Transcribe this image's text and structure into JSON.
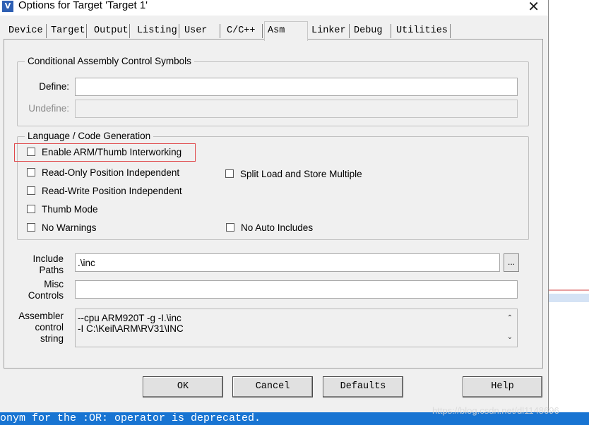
{
  "window": {
    "title": "Options for Target 'Target 1'",
    "close_glyph": "✕",
    "app_icon": "keil-uvision-icon"
  },
  "tabs": [
    {
      "label": "Device"
    },
    {
      "label": "Target"
    },
    {
      "label": "Output"
    },
    {
      "label": "Listing"
    },
    {
      "label": "User"
    },
    {
      "label": "C/C++"
    },
    {
      "label": "Asm",
      "active": true
    },
    {
      "label": "Linker"
    },
    {
      "label": "Debug"
    },
    {
      "label": "Utilities"
    }
  ],
  "conditional": {
    "group_label": "Conditional Assembly Control Symbols",
    "define_label": "Define:",
    "define_value": "",
    "undefine_label": "Undefine:",
    "undefine_value": ""
  },
  "language": {
    "group_label": "Language / Code Generation",
    "options": {
      "interworking": {
        "label": "Enable ARM/Thumb Interworking",
        "checked": false
      },
      "ropi": {
        "label": "Read-Only Position Independent",
        "checked": false
      },
      "rwpi": {
        "label": "Read-Write Position Independent",
        "checked": false
      },
      "thumb": {
        "label": "Thumb Mode",
        "checked": false
      },
      "nowarn": {
        "label": "No Warnings",
        "checked": false
      },
      "split": {
        "label": "Split Load and Store Multiple",
        "checked": false
      },
      "noauto": {
        "label": "No Auto Includes",
        "checked": false
      }
    }
  },
  "include": {
    "label_line1": "Include",
    "label_line2": "Paths",
    "value": ".\\inc",
    "browse_label": "..."
  },
  "misc": {
    "label_line1": "Misc",
    "label_line2": "Controls",
    "value": ""
  },
  "assembler": {
    "label_line1": "Assembler",
    "label_line2": "control",
    "label_line3": "string",
    "line1": "--cpu ARM920T -g -I.\\inc",
    "line2": "-I C:\\Keil\\ARM\\RV31\\INC",
    "scroll_up": "⌃",
    "scroll_down": "⌄"
  },
  "buttons": {
    "ok": "OK",
    "cancel": "Cancel",
    "defaults": "Defaults",
    "help": "Help"
  },
  "console": {
    "text": "onym for the :OR: operator is deprecated."
  },
  "watermark": "https://blog.csdn.net/dl1148696"
}
